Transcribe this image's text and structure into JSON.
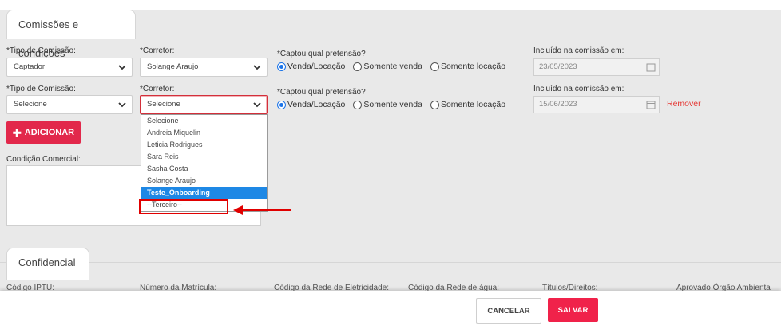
{
  "section_commissions": {
    "title": "Comissões e condições",
    "rows": [
      {
        "tipo_label": "*Tipo de Comissão:",
        "tipo_value": "Captador",
        "corretor_label": "*Corretor:",
        "corretor_value": "Solange Araujo",
        "captou_label": "*Captou qual pretensão?",
        "options": [
          "Venda/Locação",
          "Somente venda",
          "Somente locação"
        ],
        "selected_option": "Venda/Locação",
        "incluido_label": "Incluído na comissão em:",
        "incluido_value": "23/05/2023"
      },
      {
        "tipo_label": "*Tipo de Comissão:",
        "tipo_value": "Selecione",
        "corretor_label": "*Corretor:",
        "corretor_value": "Selecione",
        "captou_label": "*Captou qual pretensão?",
        "options": [
          "Venda/Locação",
          "Somente venda",
          "Somente locação"
        ],
        "selected_option": "Venda/Locação",
        "incluido_label": "Incluído na comissão em:",
        "incluido_value": "15/06/2023",
        "remove_label": "Remover"
      }
    ],
    "add_button": "ADICIONAR",
    "condicao_label": "Condição Comercial:"
  },
  "corretor_dropdown": {
    "items": [
      "Selecione",
      "Andreia Miquelin",
      "Leticia Rodrigues",
      "Sara Reis",
      "Sasha Costa",
      "Solange Araujo",
      "Teste_Onboarding",
      "--Terceiro--"
    ],
    "highlighted_item": "Teste_Onboarding",
    "annotated_item": "--Terceiro--"
  },
  "section_confidential": {
    "title": "Confidencial",
    "field_labels": [
      "Código IPTU:",
      "Número da Matrícula:",
      "Código da Rede de Eletricidade:",
      "Código da Rede de água:",
      "Títulos/Direitos:",
      "Aprovado Órgão Ambienta"
    ]
  },
  "footer": {
    "cancel_label": "CANCELAR",
    "save_label": "SALVAR"
  },
  "colors": {
    "accent": "#e2284b",
    "radio": "#1a73e8",
    "highlight": "#1e88e5",
    "annotation": "#e00000"
  },
  "icons": [
    "chevron-down-icon",
    "calendar-icon",
    "plus-icon",
    "arrow-left-icon"
  ]
}
